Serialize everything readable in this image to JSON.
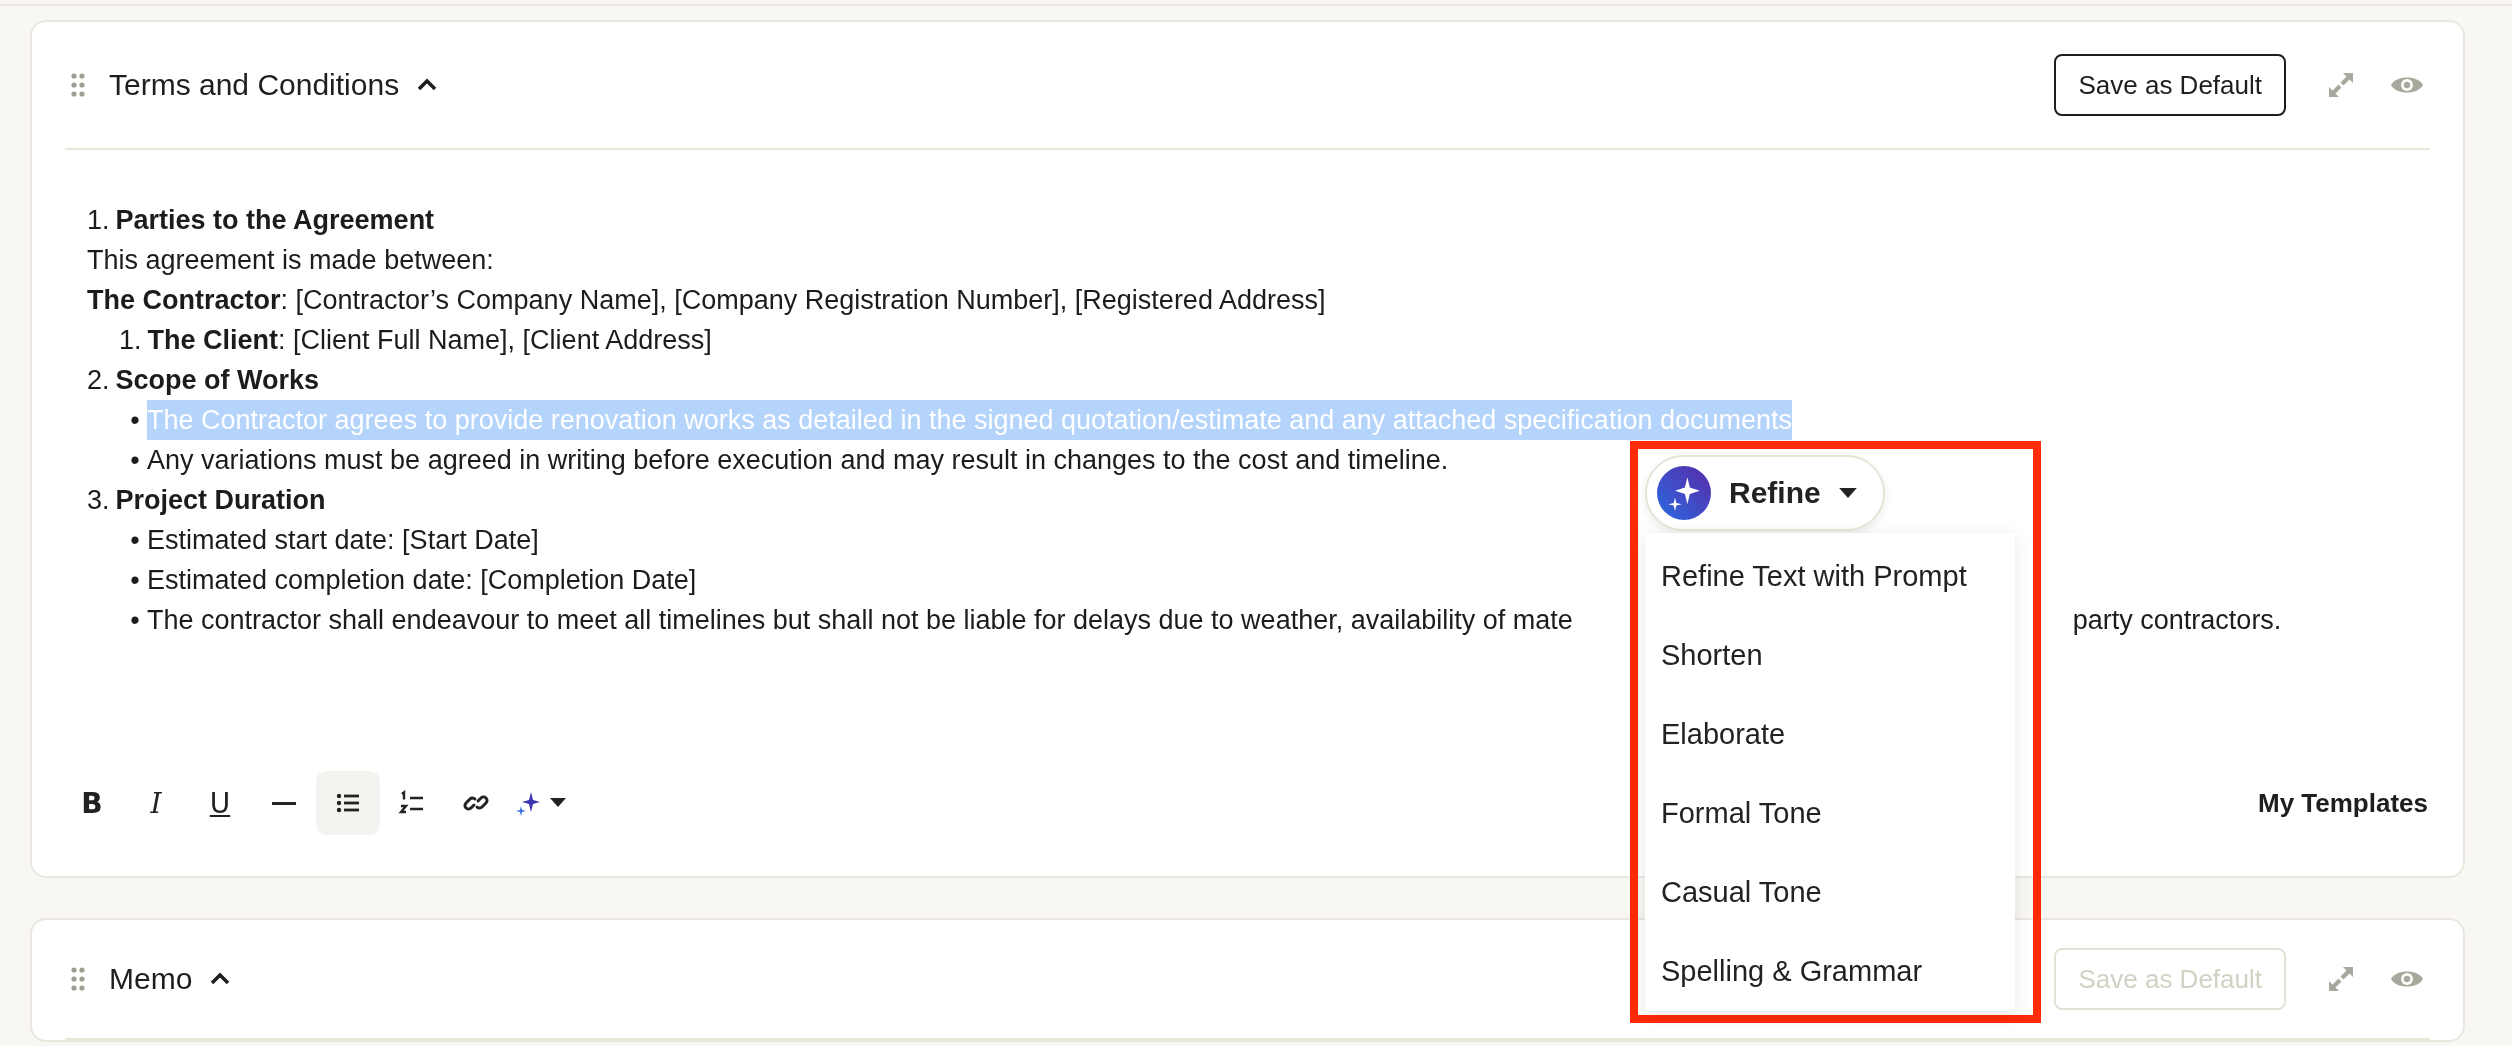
{
  "sections": [
    {
      "title": "Terms and Conditions",
      "expanded": true,
      "save_button": {
        "label": "Save as Default",
        "disabled": false
      },
      "blocks": [
        {
          "marker": "1.",
          "text": "Parties to the Agreement",
          "bold": true
        },
        {
          "text": "This agreement is made between:"
        },
        {
          "text": "**The Contractor**: [Contractor’s Company Name], [Company Registration Number], [Registered Address]",
          "children": [
            {
              "marker": "1.",
              "text": "**The Client**: [Client Full Name], [Client Address]"
            }
          ]
        },
        {
          "marker": "2.",
          "text": "Scope of Works",
          "bold": true,
          "children": [
            {
              "marker": "•",
              "text": "The Contractor agrees to provide renovation works as detailed in the signed quotation/estimate and any attached specification documents",
              "selected": true
            },
            {
              "marker": "•",
              "text": "Any variations must be agreed in writing before execution and may result in changes to the cost and timeline.",
              "selected": false
            }
          ]
        },
        {
          "marker": "3.",
          "text": "Project Duration",
          "bold": true,
          "children": [
            {
              "marker": "•",
              "text": "Estimated start date: [Start Date]",
              "selected": false
            },
            {
              "marker": "•",
              "text": "Estimated completion date: [Completion Date]",
              "selected": false
            },
            {
              "marker": "•",
              "text": "The contractor shall endeavour to meet all timelines but shall not be liable for delays due to weather, availability of mate",
              "text_continued": "party contractors.",
              "selected": false
            }
          ]
        }
      ],
      "toolbar": {
        "buttons": [
          {
            "kind": "bold",
            "label": "B",
            "active": false
          },
          {
            "kind": "italic",
            "label": "I",
            "active": false
          },
          {
            "kind": "underline",
            "label": "U",
            "active": false
          },
          {
            "kind": "rule",
            "active": false
          },
          {
            "kind": "bullet_list",
            "active": true
          },
          {
            "kind": "numbered_list",
            "active": false
          },
          {
            "kind": "link",
            "active": false
          },
          {
            "kind": "ai",
            "active": false
          }
        ],
        "link": "My Templates"
      }
    },
    {
      "title": "Memo",
      "expanded": true,
      "save_button": {
        "label": "Save as Default",
        "disabled": true
      }
    }
  ],
  "refine_popup": {
    "label": "Refine",
    "menu_items": [
      "Refine Text with Prompt",
      "Shorten",
      "Elaborate",
      "Formal Tone",
      "Casual Tone",
      "Spelling & Grammar"
    ]
  }
}
